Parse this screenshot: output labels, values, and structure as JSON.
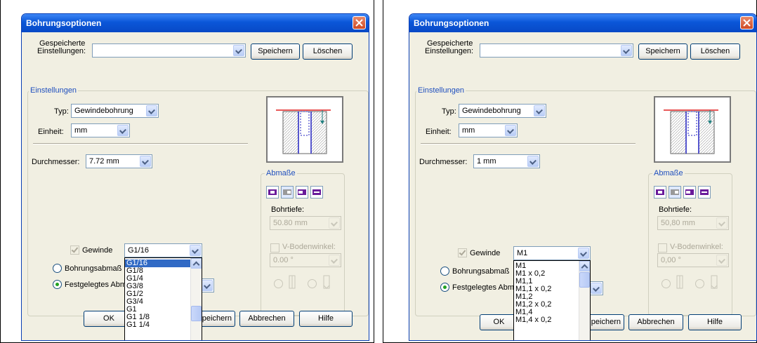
{
  "dialogs": [
    {
      "title": "Bohrungsoptionen",
      "saved_label_1": "Gespeicherte",
      "saved_label_2": "Einstellungen:",
      "saved_value": "",
      "save_button": "Speichern",
      "delete_button": "Löschen",
      "settings_group": "Einstellungen",
      "type_label": "Typ:",
      "type_value": "Gewindebohrung",
      "unit_label": "Einheit:",
      "unit_value": "mm",
      "diameter_label": "Durchmesser:",
      "diameter_value": "7.72 mm",
      "dims_group": "Abmaße",
      "depth_label": "Bohrtiefe:",
      "depth_value": "50.80 mm",
      "vangle_label": "V-Bodenwinkel:",
      "vangle_value": "0.00 °",
      "thread_label": "Gewinde",
      "thread_checked": true,
      "thread_value": "G1/16",
      "radio1_label": "Bohrungsabmaß",
      "radio2_label": "Festgelegtes Abm",
      "ok_button": "OK",
      "save_button_partial": "peichern",
      "cancel_button": "Abbrechen",
      "help_button": "Hilfe",
      "dropdown_items": [
        "G1/16",
        "G1/8",
        "G1/4",
        "G3/8",
        "G1/2",
        "G3/4",
        "G1",
        "G1 1/8",
        "G1 1/4"
      ],
      "selected_index": 0
    },
    {
      "title": "Bohrungsoptionen",
      "saved_label_1": "Gespeicherte",
      "saved_label_2": "Einstellungen:",
      "saved_value": "",
      "save_button": "Speichern",
      "delete_button": "Löschen",
      "settings_group": "Einstellungen",
      "type_label": "Typ:",
      "type_value": "Gewindebohrung",
      "unit_label": "Einheit:",
      "unit_value": "mm",
      "diameter_label": "Durchmesser:",
      "diameter_value": "1 mm",
      "dims_group": "Abmaße",
      "depth_label": "Bohrtiefe:",
      "depth_value": "50,80 mm",
      "vangle_label": "V-Bodenwinkel:",
      "vangle_value": "0,00 °",
      "thread_label": "Gewinde",
      "thread_checked": true,
      "thread_value": "M1",
      "radio1_label": "Bohrungsabmaß",
      "radio2_label": "Festgelegtes Abm",
      "ok_button": "OK",
      "save_button_partial": "peichern",
      "cancel_button": "Abbrechen",
      "help_button": "Hilfe",
      "dropdown_items": [
        "M1",
        "M1 x 0,2",
        "M1,1",
        "M1,1 x 0,2",
        "M1,2",
        "M1,2 x 0,2",
        "M1,4",
        "M1,4 x 0,2"
      ],
      "selected_index": null
    }
  ],
  "colors": {
    "title_bar": "#0a56d8",
    "dialog_bg": "#f1efe2",
    "group_legend": "#1f4fbe",
    "selection": "#316ac5",
    "preview_line_red": "#e02020",
    "preview_line_blue": "#2020c0",
    "icon_accent": "#6a1b9a"
  }
}
